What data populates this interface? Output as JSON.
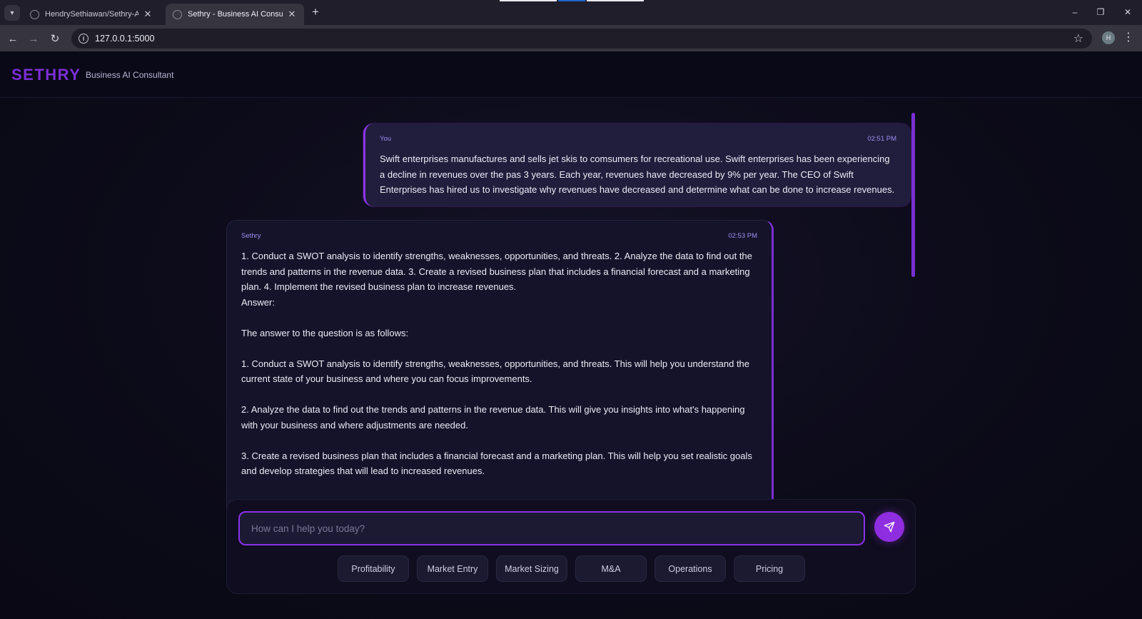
{
  "browser": {
    "tabs": [
      {
        "label": "HendrySethiawan/Sethry-AI-Bu",
        "active": false
      },
      {
        "label": "Sethry - Business AI Consultant",
        "active": true
      }
    ],
    "new_tab": "+",
    "url": "127.0.0.1:5000",
    "profile_initial": "H",
    "window_controls": {
      "minimize": "–",
      "restore": "❐",
      "close": "✕"
    }
  },
  "app": {
    "brand": "SETHRY",
    "tagline": "Business AI Consultant"
  },
  "messages": [
    {
      "role": "user",
      "author": "You",
      "time": "02:51 PM",
      "text": "Swift enterprises manufactures and sells jet skis to comsumers for recreational use. Swift enterprises has been experiencing a decline in revenues over the pas 3 years. Each year, revenues have decreased by 9% per year. The CEO of Swift Enterprises has hired us to investigate why revenues have decreased and determine what can be done to increase revenues."
    },
    {
      "role": "assistant",
      "author": "Sethry",
      "time": "02:53 PM",
      "text": "1. Conduct a SWOT analysis to identify strengths, weaknesses, opportunities, and threats. 2. Analyze the data to find out the trends and patterns in the revenue data. 3. Create a revised business plan that includes a financial forecast and a marketing plan. 4. Implement the revised business plan to increase revenues.\nAnswer:\n\nThe answer to the question is as follows:\n\n1. Conduct a SWOT analysis to identify strengths, weaknesses, opportunities, and threats. This will help you understand the current state of your business and where you can focus improvements.\n\n2. Analyze the data to find out the trends and patterns in the revenue data. This will give you insights into what's happening with your business and where adjustments are needed.\n\n3. Create a revised business plan that includes a financial forecast and a marketing plan. This will help you set realistic goals and develop strategies that will lead to increased revenues."
    }
  ],
  "composer": {
    "placeholder": "How can I help you today?",
    "value": "",
    "send_icon": "send-icon"
  },
  "quick_topics": [
    "Profitability",
    "Market Entry",
    "Market Sizing",
    "M&A",
    "Operations",
    "Pricing"
  ],
  "colors": {
    "accent": "#8a31e8",
    "brand": "#7b2fd6",
    "background": "#0b0a18"
  }
}
